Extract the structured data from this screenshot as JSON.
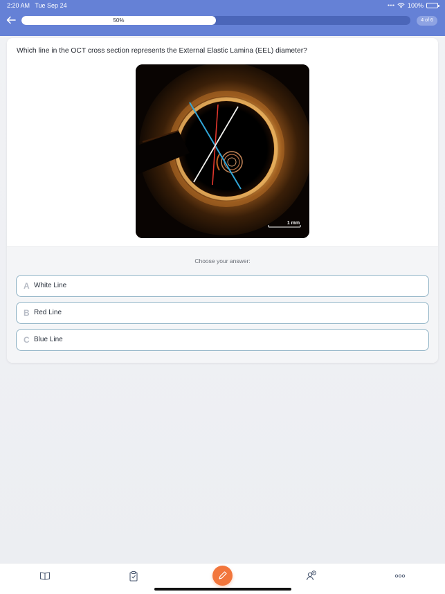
{
  "status": {
    "time": "2:20 AM",
    "date": "Tue Sep 24",
    "battery": "100%"
  },
  "progress": {
    "label": "50%",
    "fraction": 0.5,
    "counter": "4 of 6"
  },
  "question": {
    "text": "Which line in the OCT cross section represents the External Elastic Lamina (EEL) diameter?",
    "scale_label": "1 mm"
  },
  "answers": {
    "prompt": "Choose your answer:",
    "options": [
      {
        "letter": "A",
        "label": "White Line"
      },
      {
        "letter": "B",
        "label": "Red Line"
      },
      {
        "letter": "C",
        "label": "Blue Line"
      }
    ]
  },
  "icons": {
    "back": "arrow-left-icon",
    "library": "book-icon",
    "clipboard": "clipboard-icon",
    "compose": "pencil-icon",
    "people": "people-icon",
    "more": "more-icon"
  },
  "colors": {
    "header": "#6581d6",
    "accent": "#f2763c",
    "option_border": "#8fb2c5"
  }
}
